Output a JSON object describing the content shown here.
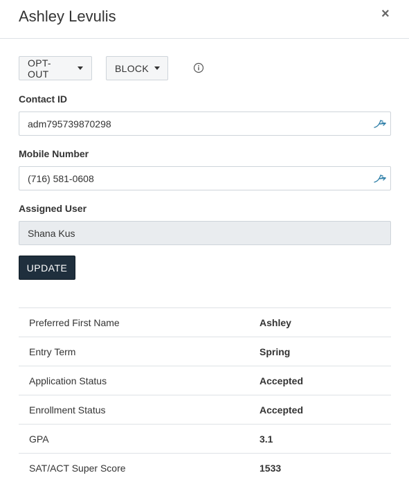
{
  "modal": {
    "title": "Ashley Levulis",
    "close_label": "×"
  },
  "toolbar": {
    "opt_out_label": "OPT-OUT",
    "block_label": "BLOCK",
    "info_icon": "info-circle-icon"
  },
  "fields": {
    "contact_id": {
      "label": "Contact ID",
      "value": "adm795739870298",
      "icon": "integration-link-icon"
    },
    "mobile_number": {
      "label": "Mobile Number",
      "value": "(716) 581-0608",
      "icon": "integration-link-icon"
    },
    "assigned_user": {
      "label": "Assigned User",
      "value": "Shana Kus"
    }
  },
  "update_label": "UPDATE",
  "details": [
    {
      "key": "Preferred First Name",
      "value": "Ashley"
    },
    {
      "key": "Entry Term",
      "value": "Spring"
    },
    {
      "key": "Application Status",
      "value": "Accepted"
    },
    {
      "key": "Enrollment Status",
      "value": "Accepted"
    },
    {
      "key": "GPA",
      "value": "3.1"
    },
    {
      "key": "SAT/ACT Super Score",
      "value": "1533"
    }
  ],
  "colors": {
    "update_button_bg": "#1f2f3d",
    "link_icon": "#2f7fa8"
  }
}
